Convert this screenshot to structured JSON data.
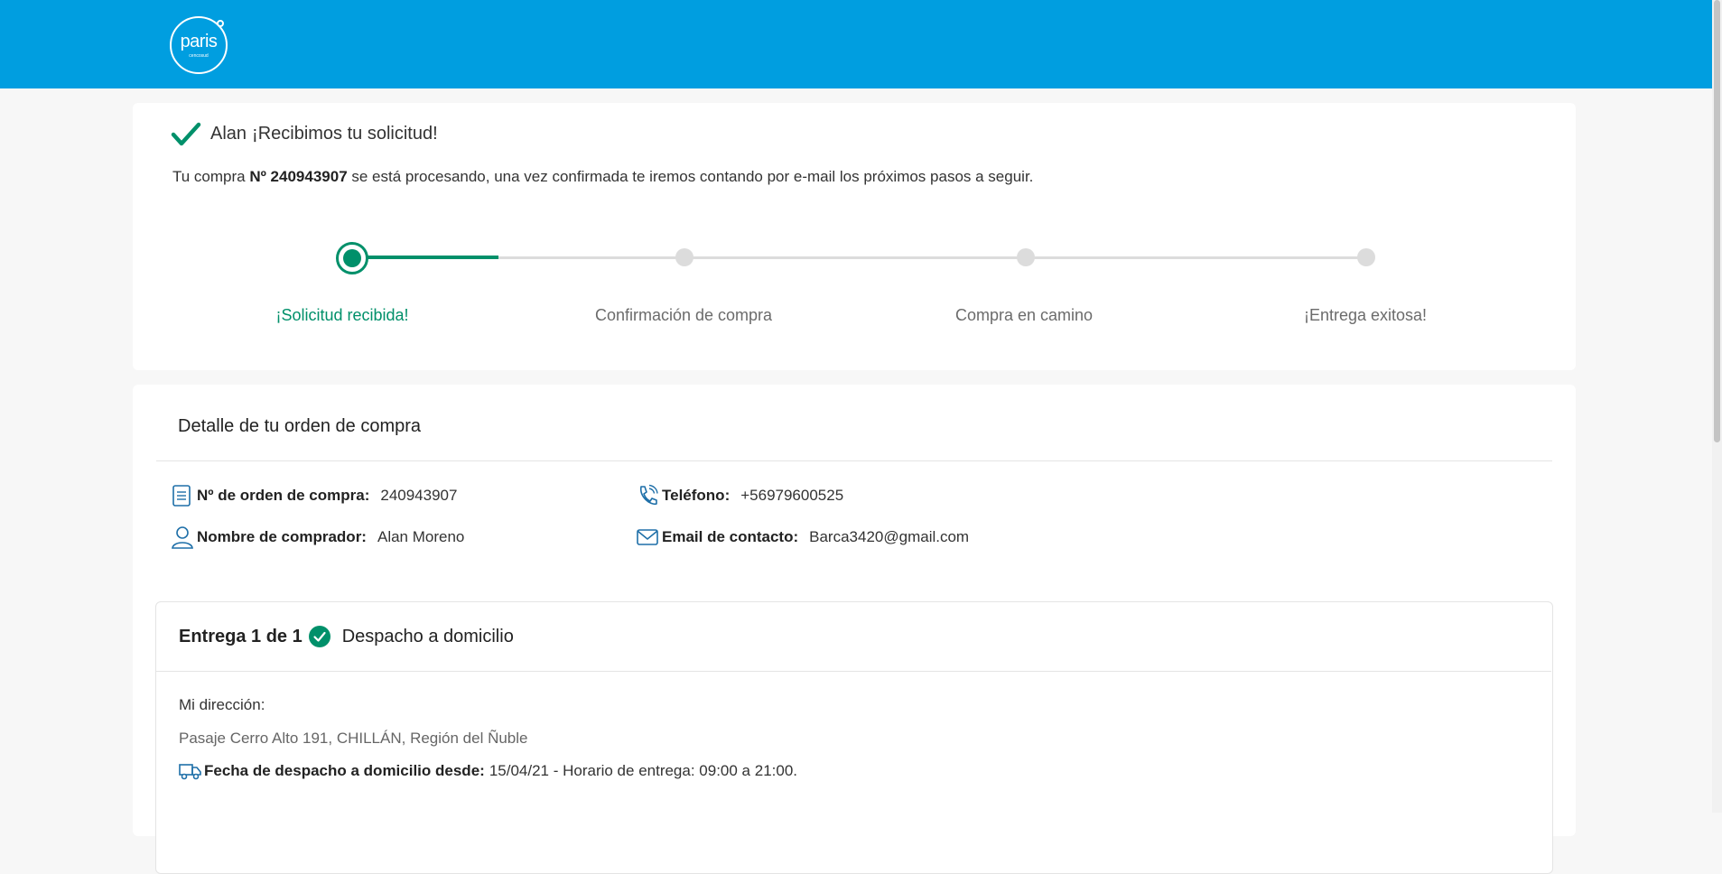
{
  "header": {
    "logo_text": "paris",
    "logo_subtext": "cencosud",
    "brand_color": "#009ee0"
  },
  "confirmation": {
    "name": "Alan",
    "message": "¡Recibimos tu solicitud!",
    "intro_prefix": "Tu compra ",
    "order_label": "Nº 240943907",
    "intro_suffix": " se está procesando, una vez confirmada te iremos contando por e-mail los próximos pasos a seguir.",
    "accent_color": "#00906a"
  },
  "progress": {
    "current_step": 1,
    "steps": [
      {
        "label": "¡Solicitud recibida!"
      },
      {
        "label": "Confirmación de compra"
      },
      {
        "label": "Compra en camino"
      },
      {
        "label": "¡Entrega exitosa!"
      }
    ]
  },
  "order_detail": {
    "title": "Detalle de tu orden de compra",
    "order_number_label": "Nº de orden de compra:",
    "order_number": "240943907",
    "buyer_label": "Nombre de comprador:",
    "buyer": "Alan Moreno",
    "phone_label": "Teléfono:",
    "phone": "+56979600525",
    "email_label": "Email de contacto:",
    "email": "Barca3420@gmail.com"
  },
  "delivery": {
    "heading": "Entrega 1 de 1",
    "type": "Despacho a domicilio",
    "address_label": "Mi dirección:",
    "address": "Pasaje Cerro Alto 191, CHILLÁN, Región del Ñuble",
    "ship_label": "Fecha de despacho a domicilio desde:",
    "ship_detail": "15/04/21 - Horario de entrega: 09:00 a 21:00."
  },
  "icons": {
    "logo": "paris-logo",
    "check": "check-icon",
    "receipt": "receipt-icon",
    "user": "user-icon",
    "phone": "phone-icon",
    "mail": "mail-icon",
    "badge": "check-circle-icon",
    "truck": "truck-icon"
  }
}
